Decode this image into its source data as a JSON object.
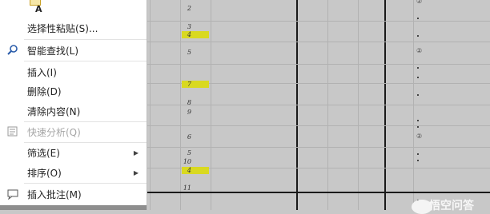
{
  "menu": {
    "paste_option_letter": "A",
    "items": [
      {
        "label": "选择性粘贴(S)...",
        "icon": "none",
        "enabled": true
      },
      {
        "label": "智能查找(L)",
        "icon": "search-icon",
        "enabled": true
      },
      {
        "label": "插入(I)",
        "icon": "none",
        "enabled": true
      },
      {
        "label": "删除(D)",
        "icon": "none",
        "enabled": true
      },
      {
        "label": "清除内容(N)",
        "icon": "none",
        "enabled": true
      },
      {
        "label": "快速分析(Q)",
        "icon": "quick-analysis-icon",
        "enabled": false
      },
      {
        "label": "筛选(E)",
        "icon": "none",
        "enabled": true,
        "submenu": true
      },
      {
        "label": "排序(O)",
        "icon": "none",
        "enabled": true,
        "submenu": true
      },
      {
        "label": "插入批注(M)",
        "icon": "comment-icon",
        "enabled": true
      }
    ]
  },
  "sheet": {
    "row_numbers": [
      "2",
      "3",
      "4",
      "5",
      "7",
      "8",
      "9",
      "6",
      "5",
      "10",
      "4",
      "11"
    ],
    "highlighted": [
      "4",
      "7",
      "4"
    ],
    "circled": [
      "②",
      "②",
      "②"
    ],
    "accent_highlight": "#d9d920"
  },
  "watermark": "悟空问答"
}
